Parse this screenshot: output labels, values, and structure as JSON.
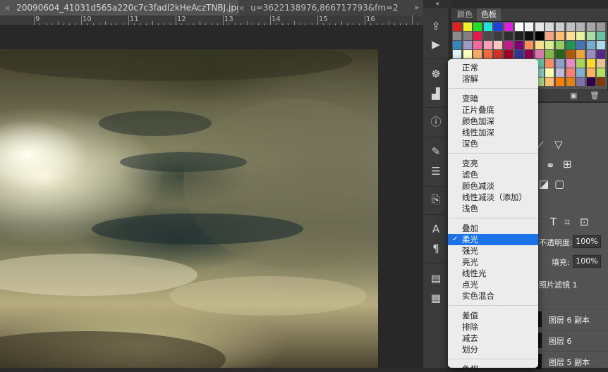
{
  "tabs": [
    {
      "label": "20090604_41031d565a220c7c3fadl2kHeAczTNBJ.jpg",
      "close": "×"
    },
    {
      "label": "u=3622138976,866717793&fm=2",
      "close": "×"
    }
  ],
  "tab_overflow": "»",
  "ruler": {
    "labels": [
      "9",
      "10",
      "11",
      "12",
      "13",
      "14",
      "15",
      "16"
    ]
  },
  "panel_collapse": "«",
  "swatch_panel": {
    "tabs": [
      "颜色",
      "色板"
    ],
    "active_tab": "色板",
    "swatches": [
      "#e02020",
      "#f0f020",
      "#20e020",
      "#20e0e0",
      "#2040e0",
      "#e020e0",
      "#ffffff",
      "#f2f2f2",
      "#e6e6e6",
      "#d9d9d9",
      "#cccccc",
      "#bfbfbf",
      "#b3b3b3",
      "#a6a6a6",
      "#999999",
      "#8c8c8c",
      "#808080",
      "#e6194b",
      "#4a4a4a",
      "#3c3c3c",
      "#2e2e2e",
      "#202020",
      "#101010",
      "#000000",
      "#f4a582",
      "#fdbf6f",
      "#fee090",
      "#e6f598",
      "#abdda4",
      "#66c2a5",
      "#3288bd",
      "#9e9ac8",
      "#f768a1",
      "#fa9fb5",
      "#fcc5c0",
      "#c51b8a",
      "#7a0177",
      "#fc8d59",
      "#fee08b",
      "#d9ef8b",
      "#91cf60",
      "#1a9850",
      "#4575b4",
      "#74add1",
      "#abd9e9",
      "#e0f3f8",
      "#ffffbf",
      "#fdae61",
      "#f46d43",
      "#d73027",
      "#a50026",
      "#313695",
      "#8e0152",
      "#de77ae",
      "#7fbc41",
      "#276419",
      "#b35806",
      "#f1a340",
      "#998ec3",
      "#542788",
      "#e31a1c",
      "#ff7f00",
      "#ffff33",
      "#4daf4a",
      "#377eb8",
      "#984ea3",
      "#a65628",
      "#f781bf",
      "#66c2a5",
      "#fc8d62",
      "#8da0cb",
      "#e78ac3",
      "#a6d854",
      "#ffd92f",
      "#e5c494",
      "#1b9e77",
      "#d95f02",
      "#7570b3",
      "#e7298a",
      "#66a61e",
      "#e6ab02",
      "#a6761d",
      "#666666",
      "#8dd3c7",
      "#ffffb3",
      "#bebada",
      "#fb8072",
      "#80b1d3",
      "#fdb462",
      "#b3de69",
      "#2a6e3b",
      "#6a3d9a",
      "#cab2d6",
      "#b15928",
      "#fb9a99",
      "#33a02c",
      "#1f78b4",
      "#a6cee3",
      "#b2df8a",
      "#fdbf6f",
      "#ff7f00",
      "#e08214",
      "#8073ac",
      "#2d004b",
      "#7f3b08"
    ]
  },
  "layers_panel": {
    "opacity_label": "不透明度:",
    "opacity_value": "100%",
    "fill_label": "填充:",
    "fill_value": "100%",
    "photo_filter": "照片滤镜 1",
    "layers": [
      "图层 6 副本",
      "图层 6",
      "图层 5 副本"
    ]
  },
  "blend_menu": {
    "groups": [
      [
        "正常",
        "溶解"
      ],
      [
        "变暗",
        "正片叠底",
        "颜色加深",
        "线性加深",
        "深色"
      ],
      [
        "变亮",
        "滤色",
        "颜色减淡",
        "线性减淡（添加）",
        "浅色"
      ],
      [
        "叠加",
        "柔光",
        "强光",
        "亮光",
        "线性光",
        "点光",
        "实色混合"
      ],
      [
        "差值",
        "排除",
        "减去",
        "划分"
      ],
      [
        "色相"
      ]
    ],
    "selected": "柔光",
    "checkmark": "✓"
  },
  "tools": [
    "move-tool-icon",
    "play-icon",
    "compass-icon",
    "histogram-icon",
    "info-icon",
    "brush-presets-icon",
    "sliders-icon",
    "clone-source-icon",
    "character-icon",
    "paragraph-icon",
    "notes-icon",
    "properties-icon"
  ],
  "colors": {
    "accent": "#1a73e8",
    "panel": "#535353",
    "menu_bg": "#ececec"
  }
}
